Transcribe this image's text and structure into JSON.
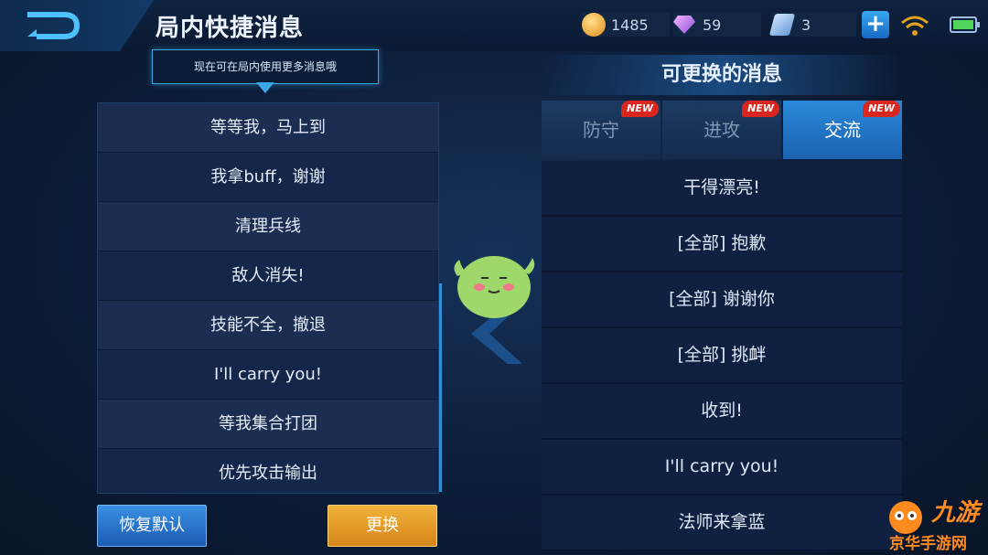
{
  "header": {
    "title": "局内快捷消息",
    "gold": "1485",
    "diamond": "59",
    "coupon": "3"
  },
  "tooltip": "现在可在局内使用更多消息哦",
  "left_list": [
    "等等我，马上到",
    "我拿buff，谢谢",
    "清理兵线",
    "敌人消失!",
    "技能不全，撤退",
    "I'll carry you!",
    "等我集合打团",
    "优先攻击输出"
  ],
  "buttons": {
    "reset": "恢复默认",
    "swap": "更换"
  },
  "right_panel": {
    "title": "可更换的消息",
    "tabs": [
      {
        "label": "防守",
        "badge": "NEW"
      },
      {
        "label": "进攻",
        "badge": "NEW"
      },
      {
        "label": "交流",
        "badge": "NEW"
      }
    ],
    "messages": [
      "干得漂亮!",
      "[全部] 抱歉",
      "[全部] 谢谢你",
      "[全部] 挑衅",
      "收到!",
      "I'll carry you!",
      "法师来拿蓝"
    ]
  },
  "watermark": {
    "brand": "九游",
    "site": "京华手游网"
  },
  "colors": {
    "accent_blue": "#2a88d8",
    "swap_orange": "#e09a28",
    "badge_red": "#d9261f"
  }
}
